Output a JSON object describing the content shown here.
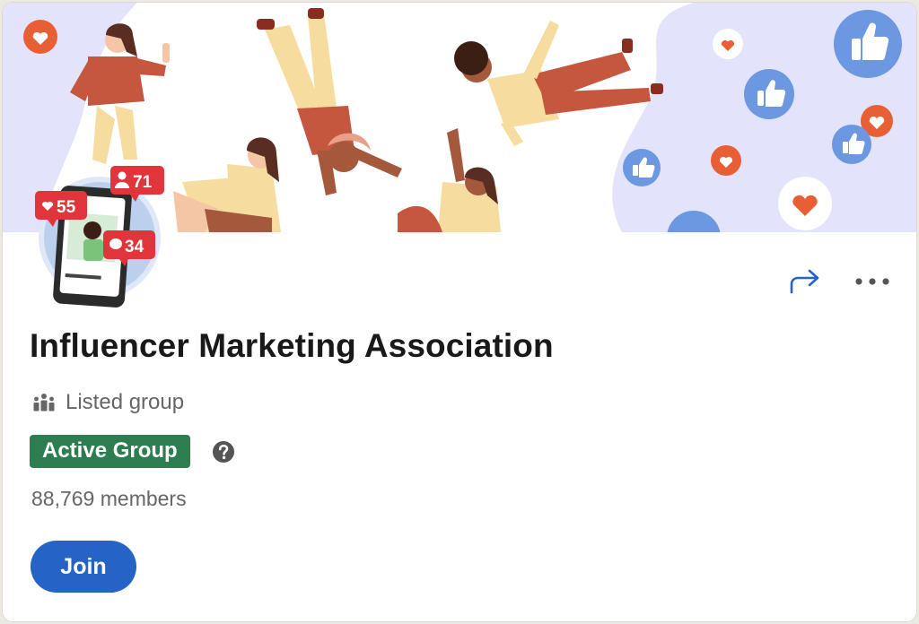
{
  "group": {
    "name": "Influencer Marketing Association",
    "privacy": "Listed group",
    "status_badge": "Active Group",
    "members": "88,769 members"
  },
  "actions": {
    "join_label": "Join",
    "share_icon": "share-arrow-icon",
    "more_icon": "more-horizontal-icon",
    "help_icon": "question-circle-icon"
  },
  "avatar": {
    "likes": "55",
    "followers": "71",
    "comments": "34"
  },
  "colors": {
    "accent": "#2564c6",
    "badge": "#2e7d50",
    "heart": "#e85f35",
    "notification": "#e0353a",
    "banner_lavender": "#e3e3fb",
    "thumb_blue": "#6b98e0"
  }
}
